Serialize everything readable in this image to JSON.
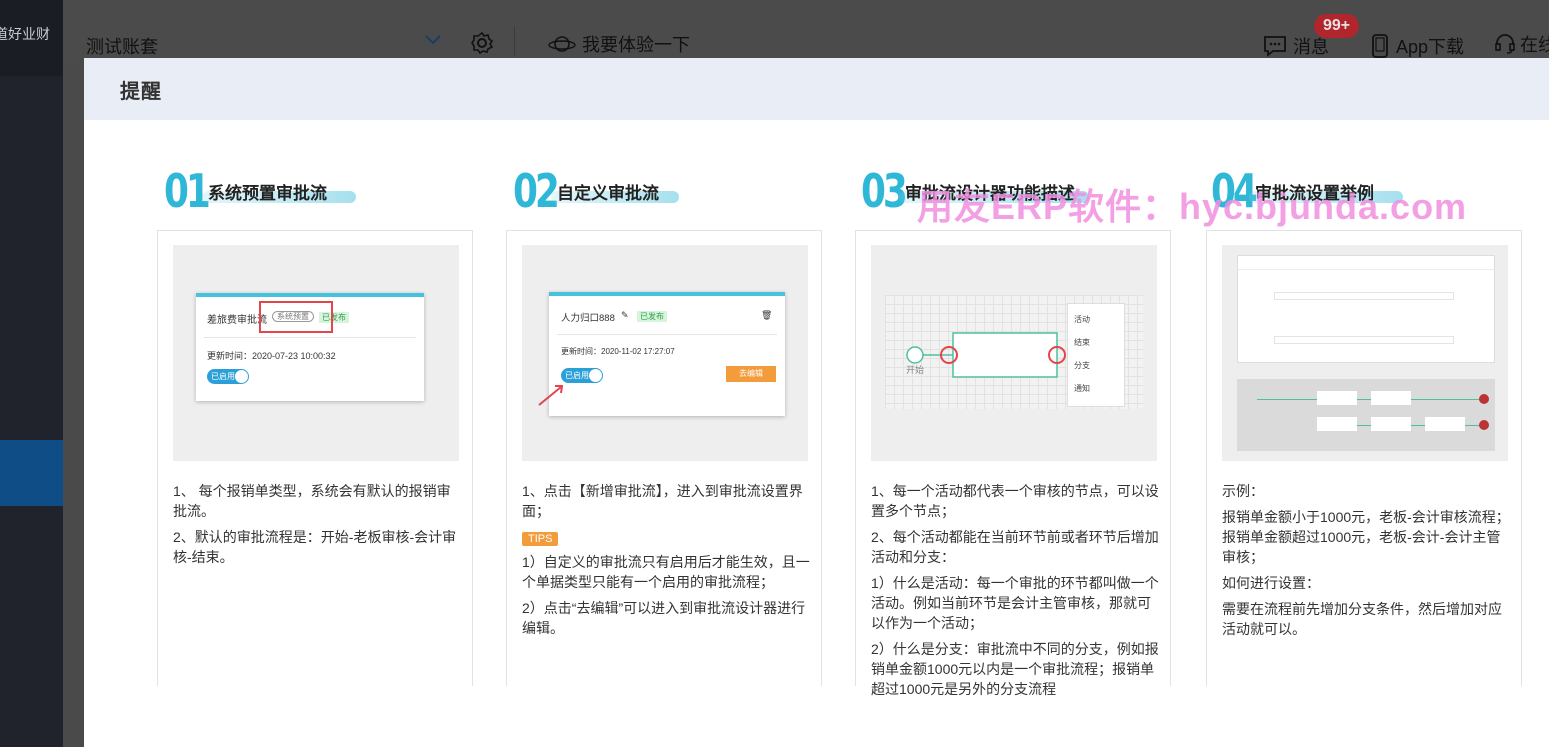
{
  "sidebar": {
    "brand": "道好业财"
  },
  "header": {
    "account": "测试账套",
    "try_label": "我要体验一下",
    "messages_label": "消息",
    "messages_badge": "99+",
    "app_label": "App下载",
    "online_label": "在线"
  },
  "modal": {
    "title": "提醒",
    "watermark": "用友ERP软件：hyc.bjunda.com",
    "cards": [
      {
        "num": "01",
        "title": "系统预置审批流",
        "shot": {
          "name": "差旅费审批流",
          "tag_system": "系统预置",
          "tag_published": "已发布",
          "updated": "更新时间：2020-07-23 10:00:32",
          "toggle": "已启用"
        },
        "text": [
          "1、 每个报销单类型，系统会有默认的报销审批流。",
          "2、默认的审批流程是：开始-老板审核-会计审核-结束。"
        ]
      },
      {
        "num": "02",
        "title": "自定义审批流",
        "shot": {
          "name": "人力归口888",
          "tag_published": "已发布",
          "updated": "更新时间：2020-11-02 17:27:07",
          "toggle": "已启用",
          "edit_btn": "去编辑"
        },
        "text": [
          "1、点击【新增审批流】，进入到审批流设置界面；",
          "1）自定义的审批流只有启用后才能生效，且一个单据类型只能有一个启用的审批流程；",
          "2）点击“去编辑”可以进入到审批流设计器进行编辑。"
        ],
        "tips": "TIPS"
      },
      {
        "num": "03",
        "title": "审批流设计器功能描述",
        "shot": {
          "start": "开始",
          "menu": [
            "活动",
            "结束",
            "分支",
            "通知"
          ]
        },
        "text": [
          "1、每一个活动都代表一个审核的节点，可以设置多个节点；",
          "2、每个活动都能在当前环节前或者环节后增加活动和分支：",
          "1）什么是活动：每一个审批的环节都叫做一个活动。例如当前环节是会计主管审核，那就可以作为一个活动；",
          "2）什么是分支：审批流中不同的分支，例如报销单金额1000元以内是一个审批流程；报销单超过1000元是另外的分支流程"
        ]
      },
      {
        "num": "04",
        "title": "审批流设置举例",
        "text": [
          "示例：",
          "报销单金额小于1000元，老板-会计审核流程；报销单金额超过1000元，老板-会计-会计主管审核；",
          "如何进行设置：",
          "需要在流程前先增加分支条件，然后增加对应活动就可以。"
        ]
      }
    ]
  },
  "colors": {
    "accent": "#2fb7d8",
    "watermark": "#f08fe0",
    "badge": "#b0262c",
    "tips": "#f39c3b"
  }
}
